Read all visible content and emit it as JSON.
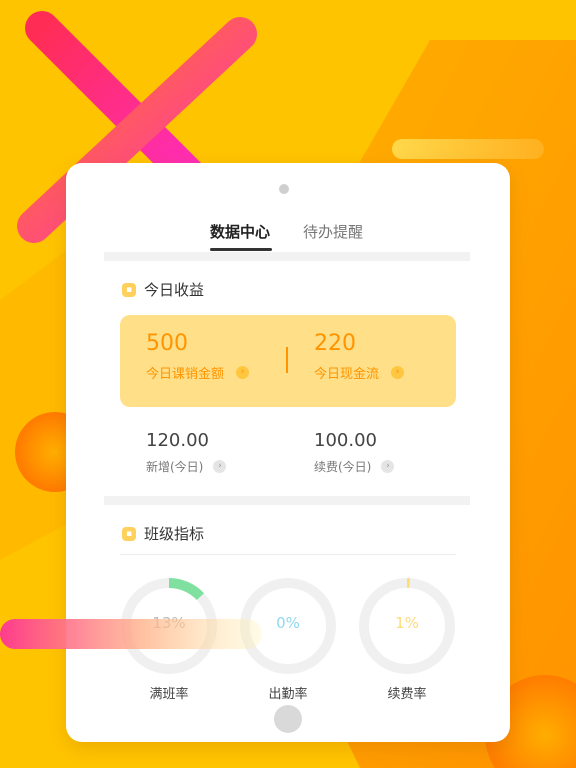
{
  "tabs": [
    {
      "label": "数据中心",
      "active": true
    },
    {
      "label": "待办提醒",
      "active": false
    }
  ],
  "today": {
    "title": "今日收益",
    "cards": [
      {
        "value": "500",
        "label": "今日课销金额"
      },
      {
        "value": "220",
        "label": "今日现金流"
      }
    ],
    "stats": [
      {
        "value": "120.00",
        "label": "新增(今日)"
      },
      {
        "value": "100.00",
        "label": "续费(今日)"
      }
    ]
  },
  "class_metrics": {
    "title": "班级指标",
    "rings": [
      {
        "percent_text": "13%",
        "label": "满班率",
        "value": 0.13,
        "color": "#7fe0a0",
        "text_color": "#b9b9b9"
      },
      {
        "percent_text": "0%",
        "label": "出勤率",
        "value": 0.0,
        "color": "#8fd8ef",
        "text_color": "#8fd8ef"
      },
      {
        "percent_text": "1%",
        "label": "续费率",
        "value": 0.01,
        "color": "#ffdc7a",
        "text_color": "#ffdc7a"
      }
    ]
  },
  "colors": {
    "background": "#ffc400",
    "accent_orange": "#ff9400",
    "card_yellow": "#ffe088"
  },
  "icons": {
    "revenue": "coin-icon",
    "metrics": "chart-icon",
    "arrow": "chevron-right-icon"
  }
}
